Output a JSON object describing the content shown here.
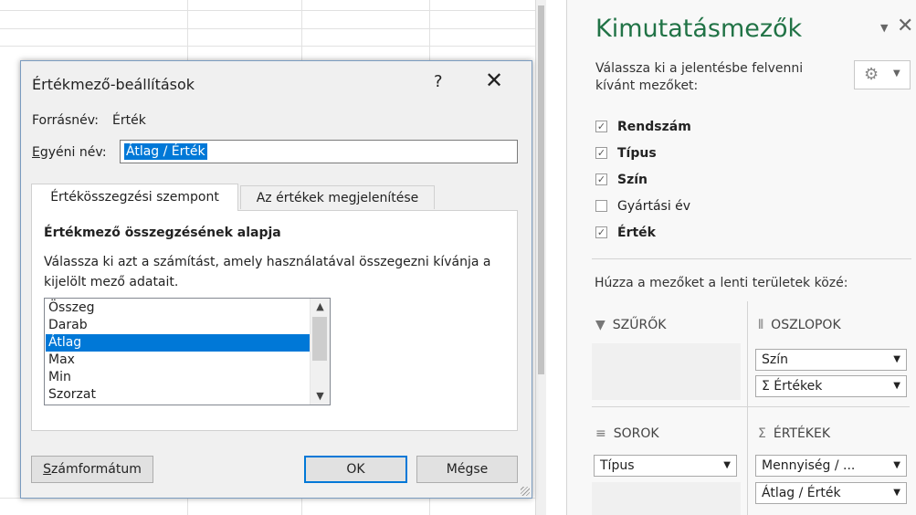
{
  "dialog": {
    "title": "Értékmező-beállítások",
    "help": "?",
    "close": "✕",
    "source_label": "Forrásnév:",
    "source_value": "Érték",
    "custom_name_label": "Egyéni név:",
    "custom_name_value": "Átlag / Érték",
    "tabs": [
      {
        "label": "Értékösszegzési szempont"
      },
      {
        "label": "Az értékek megjelenítése"
      }
    ],
    "panel_title": "Értékmező összegzésének alapja",
    "panel_desc": "Válassza ki azt a számítást, amely használatával összegezni kívánja a kijelölt mező adatait.",
    "functions": [
      "Összeg",
      "Darab",
      "Átlag",
      "Max",
      "Min",
      "Szorzat"
    ],
    "selected_function": "Átlag",
    "number_format_button": "Számformátum",
    "ok_button": "OK",
    "cancel_button": "Mégse"
  },
  "pane": {
    "title": "Kimutatásmezők",
    "hint": "Válassza ki a jelentésbe felvenni kívánt mezőket:",
    "fields": [
      {
        "label": "Rendszám",
        "checked": true
      },
      {
        "label": "Típus",
        "checked": true
      },
      {
        "label": "Szín",
        "checked": true
      },
      {
        "label": "Gyártási év",
        "checked": false
      },
      {
        "label": "Érték",
        "checked": true
      }
    ],
    "drag_hint": "Húzza a mezőket a lenti területek közé:",
    "areas": {
      "filters": {
        "label": "SZŰRŐK",
        "items": []
      },
      "columns": {
        "label": "OSZLOPOK",
        "items": [
          "Szín",
          "Σ  Értékek"
        ]
      },
      "rows": {
        "label": "SOROK",
        "items": [
          "Típus"
        ]
      },
      "values": {
        "label": "ÉRTÉKEK",
        "items": [
          "Mennyiség / ...",
          "Átlag / Érték"
        ]
      }
    }
  },
  "colors": {
    "accent": "#0078d7",
    "pane_title": "#217346"
  }
}
